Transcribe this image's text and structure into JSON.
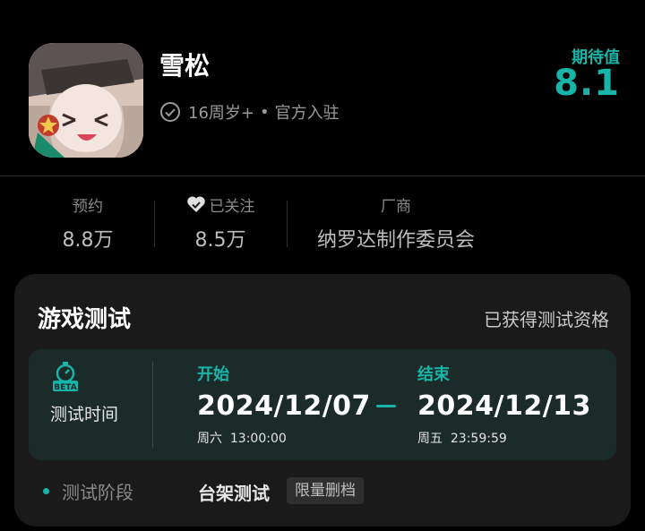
{
  "game": {
    "title": "雪松",
    "age_rating": "16周岁+",
    "separator": "•",
    "official": "官方入驻",
    "expect_label": "期待值",
    "expect_score": "8.1"
  },
  "stats": [
    {
      "label": "预约",
      "value": "8.8万"
    },
    {
      "label": "已关注",
      "value": "8.5万"
    },
    {
      "label": "厂商",
      "value": "纳罗达制作委员会"
    }
  ],
  "test_card": {
    "title": "游戏测试",
    "status": "已获得测试资格",
    "time_label": "测试时间",
    "badge": "BETA",
    "start": {
      "head": "开始",
      "date": "2024/12/07",
      "sub": "周六  13:00:00"
    },
    "end": {
      "head": "结束",
      "date": "2024/12/13",
      "sub": "周五  23:59:59"
    },
    "stage_label": "测试阶段",
    "stage_value": "台架测试",
    "stage_tag": "限量删档"
  },
  "colors": {
    "accent": "#19b4a8",
    "background": "#000000",
    "card": "#1a1a1a"
  },
  "icons": {
    "verified": "check-circle-icon",
    "followed": "heart-check-icon",
    "test_time": "stopwatch-beta-icon"
  }
}
